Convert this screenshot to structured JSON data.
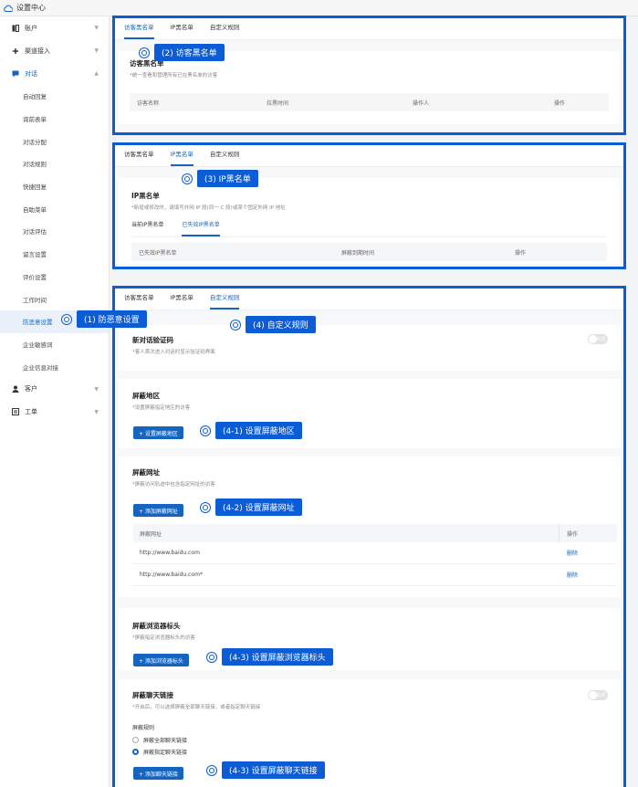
{
  "window": {
    "title": "设置中心"
  },
  "sidebar": {
    "account": "账户",
    "channel": "渠道接入",
    "dialog": "对话",
    "items": [
      "自动回复",
      "询前表单",
      "对话分配",
      "对话规则",
      "快捷回复",
      "自助菜单",
      "对话评估",
      "留言设置",
      "评价设置",
      "工作时间",
      "防恶意设置",
      "企业敏感词",
      "企业信息对接"
    ],
    "customer": "客户",
    "ticket": "工单"
  },
  "tabs": {
    "visitor": "访客黑名单",
    "ip": "IP黑名单",
    "custom": "自定义规则"
  },
  "p1": {
    "title": "访客黑名单",
    "desc": "*统一查看和管理所有已在黑名单的访客",
    "cols": [
      "访客名称",
      "拉黑时间",
      "操作人",
      "操作"
    ]
  },
  "p2": {
    "title": "IP黑名单",
    "desc": "*新增或修改时，请填写外网 IP 段(同一 C 段)或某个固定外网 IP 地址",
    "sub_current": "当前IP黑名单",
    "sub_expired": "已失效IP黑名单",
    "cols": [
      "已失效IP黑名单",
      "屏蔽到期时间",
      "操作"
    ]
  },
  "p3": {
    "captcha_title": "新对话验证码",
    "captcha_desc": "*客人首次进入对话时显示验证码界面",
    "toggle_off": "关闭",
    "region_title": "屏蔽地区",
    "region_desc": "*设置屏蔽指定地区的访客",
    "region_btn": "+ 设置屏蔽地区",
    "url_title": "屏蔽网址",
    "url_desc": "*屏蔽访问轨迹中包含指定网址的访客",
    "url_btn": "+ 添加屏蔽网址",
    "url_cols": [
      "屏蔽网址",
      "操作"
    ],
    "urls": [
      {
        "url": "http://www.baidu.com",
        "op": "删除"
      },
      {
        "url": "http://www.baidu.com*",
        "op": "删除"
      }
    ],
    "ua_title": "屏蔽浏览器标头",
    "ua_desc": "*屏蔽指定浏览器标头的访客",
    "ua_btn": "+ 添加浏览器标头",
    "chat_title": "屏蔽聊天链接",
    "chat_desc": "*开启后，可以选择屏蔽全部聊天链接，或者指定聊天链接",
    "rule_label": "屏蔽规则",
    "rule_all": "屏蔽全部聊天链接",
    "rule_some": "屏蔽指定聊天链接",
    "chat_btn": "+ 添加聊天链接"
  },
  "callouts": {
    "c1": "(1) 防恶意设置",
    "c2": "(2) 访客黑名单",
    "c3": "(3) IP黑名单",
    "c4": "(4) 自定义规则",
    "c41": "(4-1) 设置屏蔽地区",
    "c42": "(4-2) 设置屏蔽网址",
    "c43a": "(4-3) 设置屏蔽浏览器标头",
    "c43b": "(4-3) 设置屏蔽聊天链接"
  },
  "colors": {
    "accent": "#1565c0",
    "frame": "#0b5cd5"
  }
}
